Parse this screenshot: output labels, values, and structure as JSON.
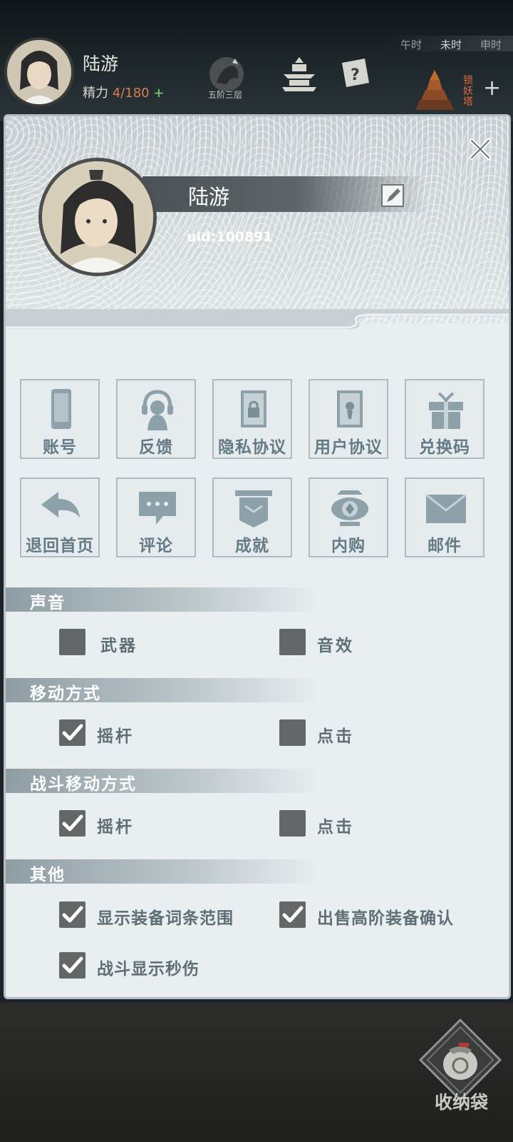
{
  "hud": {
    "player_name": "陆游",
    "energy_label": "精力",
    "energy_value": "4/180",
    "energy_plus": "+",
    "realm_label": "五阶三层",
    "time_labels": [
      "午时",
      "未时",
      "申时"
    ],
    "tower_label": "锁妖塔",
    "add_symbol": "+"
  },
  "panel": {
    "profile_name": "陆游",
    "uid": "uid:100891",
    "grid_row1": [
      {
        "label": "账号",
        "icon": "phone-icon"
      },
      {
        "label": "反馈",
        "icon": "headset-icon"
      },
      {
        "label": "隐私协议",
        "icon": "privacy-document-icon"
      },
      {
        "label": "用户协议",
        "icon": "user-document-icon"
      },
      {
        "label": "兑换码",
        "icon": "gift-icon"
      }
    ],
    "grid_row2": [
      {
        "label": "退回首页",
        "icon": "back-arrow-icon"
      },
      {
        "label": "评论",
        "icon": "comment-icon"
      },
      {
        "label": "成就",
        "icon": "achievement-icon"
      },
      {
        "label": "内购",
        "icon": "shop-icon"
      },
      {
        "label": "邮件",
        "icon": "mail-icon"
      }
    ],
    "sections": {
      "sound": {
        "title": "声音",
        "opt1": "武器",
        "opt1_checked": false,
        "opt2": "音效",
        "opt2_checked": false
      },
      "move": {
        "title": "移动方式",
        "opt1": "摇杆",
        "opt1_checked": true,
        "opt2": "点击",
        "opt2_checked": false
      },
      "battle_move": {
        "title": "战斗移动方式",
        "opt1": "摇杆",
        "opt1_checked": true,
        "opt2": "点击",
        "opt2_checked": false
      },
      "other": {
        "title": "其他",
        "opt1": "显示装备词条范围",
        "opt1_checked": true,
        "opt2": "出售高阶装备确认",
        "opt2_checked": true,
        "opt3": "战斗显示秒伤",
        "opt3_checked": true
      }
    }
  },
  "bag_label": "收纳袋",
  "colors": {
    "accent_text": "#647b86",
    "checkbox": "#646768",
    "energy": "#d97a52"
  }
}
